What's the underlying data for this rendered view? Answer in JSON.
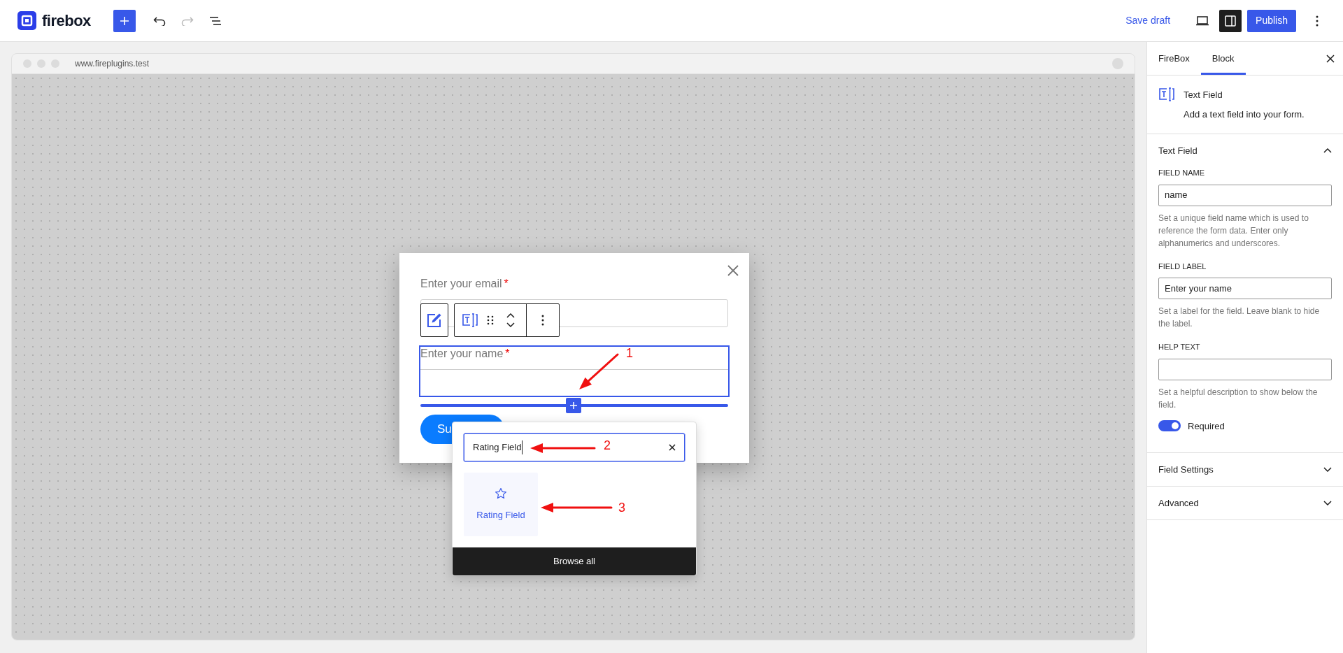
{
  "topbar": {
    "logo": "firebox",
    "undo": {
      "disabled": false
    },
    "redo": {
      "disabled": true
    },
    "save_draft": "Save draft",
    "settings_toggle": {
      "selected": true
    },
    "publish": "Publish"
  },
  "browser": {
    "url": "www.fireplugins.test"
  },
  "form": {
    "fields": [
      {
        "label": "Enter your email",
        "required_mark": "*",
        "selected": false
      },
      {
        "label": "Enter your name",
        "required_mark": "*",
        "selected": true
      }
    ],
    "submit": "Su"
  },
  "inserter": {
    "search_value": "Rating Field",
    "results": [
      {
        "label": "Rating Field"
      }
    ],
    "browse_all": "Browse all"
  },
  "annotations": [
    "1",
    "2",
    "3"
  ],
  "sidebar": {
    "tabs": [
      {
        "label": "FireBox",
        "selected": false
      },
      {
        "label": "Block",
        "selected": true
      }
    ],
    "block": {
      "title": "Text Field",
      "description": "Add a text field into your form."
    },
    "panels": [
      {
        "title": "Text Field",
        "expanded": true,
        "settings": [
          {
            "kind": "input",
            "label": "FIELD NAME",
            "value": "name",
            "help": "Set a unique field name which is used to reference the form data. Enter only alphanumerics and underscores."
          },
          {
            "kind": "input",
            "label": "FIELD LABEL",
            "value": "Enter your name",
            "help": "Set a label for the field. Leave blank to hide the label."
          },
          {
            "kind": "input",
            "label": "HELP TEXT",
            "help": "Set a helpful description to show below the field."
          },
          {
            "kind": "toggle",
            "label": "Required",
            "on": true
          }
        ]
      },
      {
        "title": "Field Settings",
        "expanded": false
      },
      {
        "title": "Advanced",
        "expanded": false
      }
    ]
  }
}
